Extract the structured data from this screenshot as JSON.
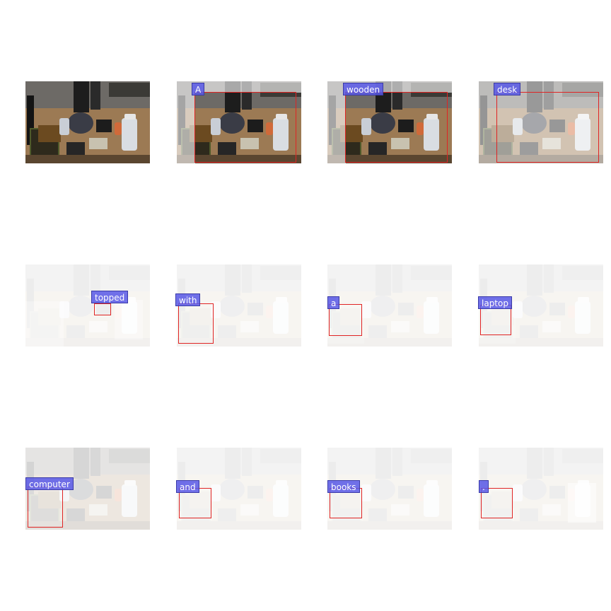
{
  "grid": {
    "tokens": [
      "A",
      "wooden",
      "desk",
      "topped",
      "with",
      "a",
      "laptop",
      "computer",
      "and",
      "books",
      "."
    ]
  },
  "colors": {
    "box_stroke": "#e02424",
    "label_fill": "#5858e6",
    "label_border": "#3a3aa8",
    "label_text": "#ffffff"
  }
}
